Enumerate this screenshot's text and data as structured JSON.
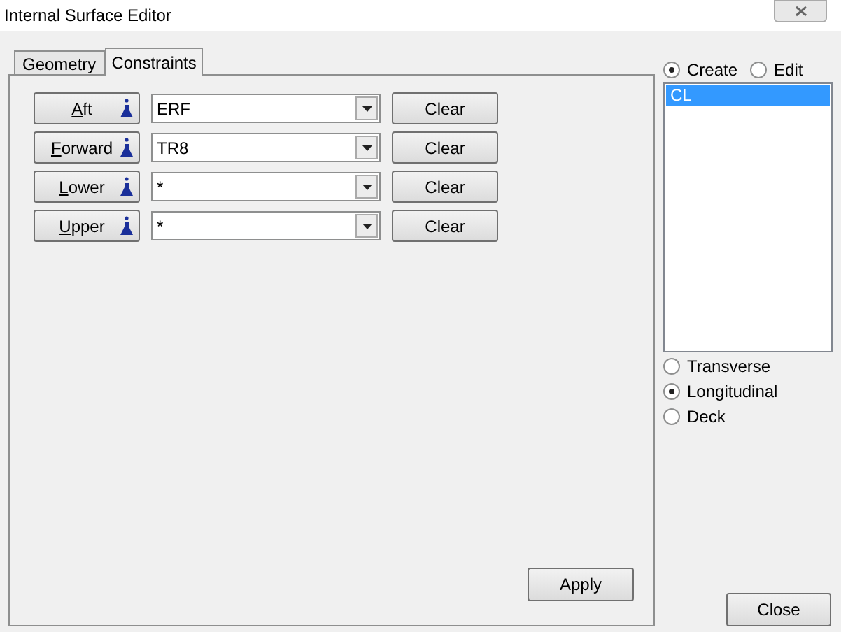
{
  "window": {
    "title": "Internal Surface Editor"
  },
  "tabs": [
    {
      "label": "Geometry",
      "selected": false
    },
    {
      "label": "Constraints",
      "selected": true
    }
  ],
  "constraints": [
    {
      "label": "Aft",
      "value": "ERF",
      "clear": "Clear"
    },
    {
      "label": "Forward",
      "value": "TR8",
      "clear": "Clear"
    },
    {
      "label": "Lower",
      "value": "*",
      "clear": "Clear"
    },
    {
      "label": "Upper",
      "value": "*",
      "clear": "Clear"
    }
  ],
  "apply_button": "Apply",
  "mode": [
    {
      "label": "Create",
      "selected": true
    },
    {
      "label": "Edit",
      "selected": false
    }
  ],
  "list": [
    {
      "label": "CL",
      "selected": true
    }
  ],
  "orientation": [
    {
      "label": "Transverse",
      "selected": false
    },
    {
      "label": "Longitudinal",
      "selected": true
    },
    {
      "label": "Deck",
      "selected": false
    }
  ],
  "close_button": "Close"
}
